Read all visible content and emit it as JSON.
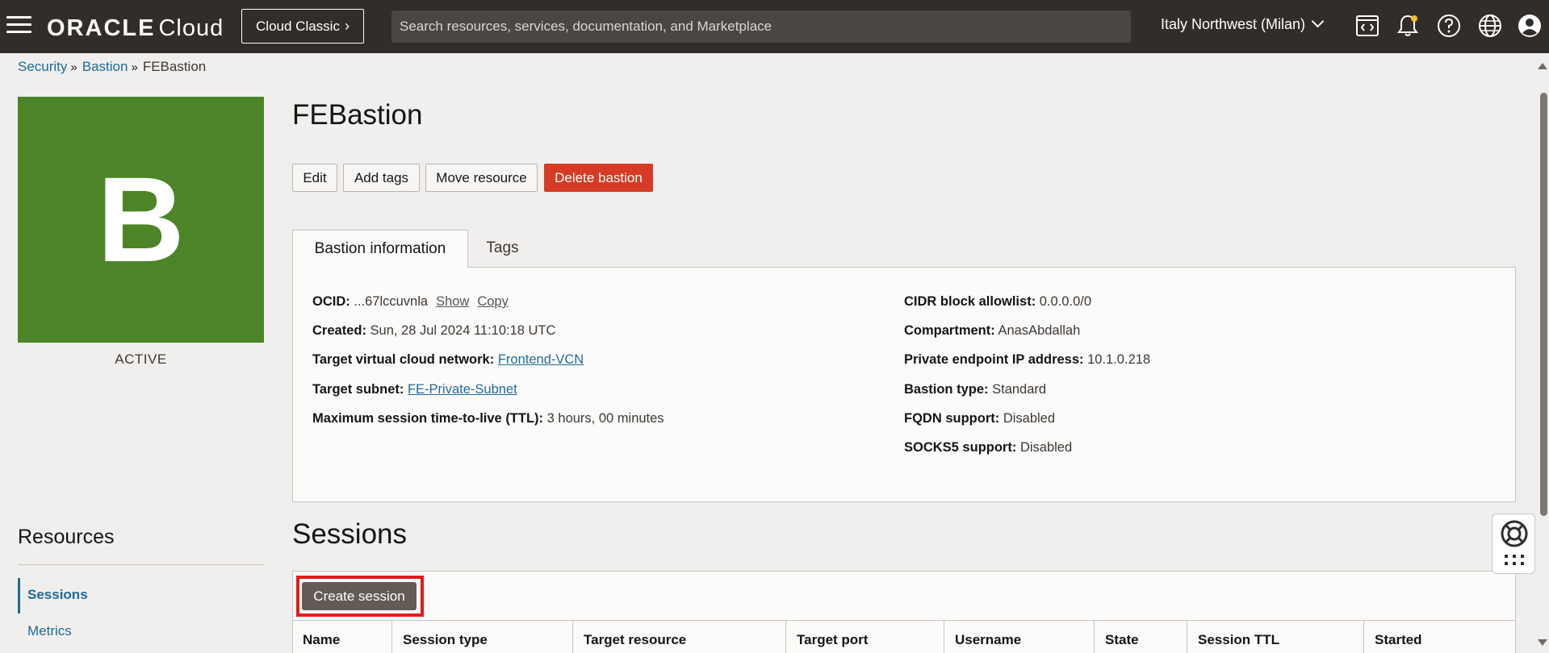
{
  "header": {
    "logo_oracle": "ORACLE",
    "logo_cloud": "Cloud",
    "classic_button": "Cloud Classic",
    "search_placeholder": "Search resources, services, documentation, and Marketplace",
    "region": "Italy Northwest (Milan)"
  },
  "breadcrumb": {
    "items": [
      "Security",
      "Bastion"
    ],
    "separator": "»",
    "current": "FEBastion"
  },
  "tile": {
    "letter": "B",
    "status": "ACTIVE",
    "color": "#4b8527"
  },
  "page": {
    "title": "FEBastion",
    "actions": {
      "edit": "Edit",
      "add_tags": "Add tags",
      "move_resource": "Move resource",
      "delete_bastion": "Delete bastion"
    },
    "tabs": [
      "Bastion information",
      "Tags"
    ]
  },
  "info": {
    "ocid_label": "OCID:",
    "ocid_value": "...67lccuvnla",
    "ocid_show": "Show",
    "ocid_copy": "Copy",
    "created_label": "Created:",
    "created_value": "Sun, 28 Jul 2024 11:10:18 UTC",
    "vcn_label": "Target virtual cloud network:",
    "vcn_value": "Frontend-VCN",
    "subnet_label": "Target subnet:",
    "subnet_value": "FE-Private-Subnet",
    "ttl_label": "Maximum session time-to-live (TTL):",
    "ttl_value": "3 hours, 00 minutes",
    "cidr_label": "CIDR block allowlist:",
    "cidr_value": "0.0.0.0/0",
    "compartment_label": "Compartment:",
    "compartment_value": "AnasAbdallah",
    "private_ip_label": "Private endpoint IP address:",
    "private_ip_value": "10.1.0.218",
    "type_label": "Bastion type:",
    "type_value": "Standard",
    "fqdn_label": "FQDN support:",
    "fqdn_value": "Disabled",
    "socks5_label": "SOCKS5 support:",
    "socks5_value": "Disabled"
  },
  "resources": {
    "title": "Resources",
    "items": [
      "Sessions",
      "Metrics"
    ]
  },
  "sessions": {
    "title": "Sessions",
    "create_button": "Create session",
    "columns": [
      "Name",
      "Session type",
      "Target resource",
      "Target port",
      "Username",
      "State",
      "Session TTL",
      "Started"
    ]
  },
  "colors": {
    "topbar": "#312d2a",
    "danger": "#d63b25",
    "link": "#1e6b9a",
    "highlight": "#e31b1b"
  }
}
